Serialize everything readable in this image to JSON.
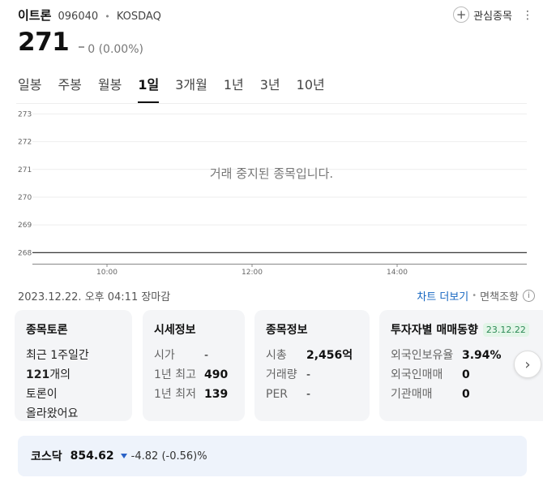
{
  "stock": {
    "name": "이트론",
    "code": "096040",
    "separator": "•",
    "market": "KOSDAQ",
    "price": "271",
    "change": "0 (0.00%)"
  },
  "header": {
    "watch_label": "관심종목"
  },
  "tabs": [
    {
      "label": "일봉",
      "active": false
    },
    {
      "label": "주봉",
      "active": false
    },
    {
      "label": "월봉",
      "active": false
    },
    {
      "label": "1일",
      "active": true
    },
    {
      "label": "3개월",
      "active": false
    },
    {
      "label": "1년",
      "active": false
    },
    {
      "label": "3년",
      "active": false
    },
    {
      "label": "10년",
      "active": false
    }
  ],
  "chart_data": {
    "type": "line",
    "message": "거래 중지된 종목입니다.",
    "y_ticks": [
      273,
      272,
      271,
      270,
      269,
      268
    ],
    "ylim": [
      267.6,
      273.1
    ],
    "x_ticks": [
      "10:00",
      "12:00",
      "14:00"
    ],
    "series": [
      {
        "values": [
          268,
          268
        ]
      }
    ],
    "grid": true
  },
  "meta": {
    "timestamp": "2023.12.22. 오후 04:11 장마감",
    "chart_more": "차트 더보기",
    "separator": "•",
    "disclaimer": "면책조항",
    "info_icon": "i"
  },
  "cards": {
    "discussion": {
      "title": "종목토론",
      "line1": "최근 1주일간",
      "count": "121",
      "line2": "개의",
      "line3": "토론이",
      "line4": "올라왔어요"
    },
    "market_info": {
      "title": "시세정보",
      "rows": [
        {
          "k": "시가",
          "v": "-"
        },
        {
          "k": "1년 최고",
          "v": "490"
        },
        {
          "k": "1년 최저",
          "v": "139"
        }
      ]
    },
    "stock_info": {
      "title": "종목정보",
      "rows": [
        {
          "k": "시총",
          "v": "2,456억"
        },
        {
          "k": "거래량",
          "v": "-"
        },
        {
          "k": "PER",
          "v": "-"
        }
      ]
    },
    "investor": {
      "title": "투자자별 매매동향",
      "badge": "23.12.22",
      "rows": [
        {
          "k": "외국인보유율",
          "v": "3.94%"
        },
        {
          "k": "외국인매매",
          "v": "0"
        },
        {
          "k": "기관매매",
          "v": "0"
        }
      ]
    }
  },
  "index": {
    "name": "코스닥",
    "value": "854.62",
    "change": "-4.82 (-0.56)%"
  },
  "colors": {
    "chart_more": "#1565c0",
    "index_down": "#2a62c7",
    "badge_bg": "#e3f5e8",
    "badge_fg": "#2e8b57",
    "index_bg": "#eef3fb",
    "card_bg": "#f4f5f7"
  },
  "icons": {
    "watch": "plus-icon",
    "more": "more-vertical-icon",
    "next": "chevron-right-icon",
    "down": "triangle-down-icon",
    "info": "info-icon"
  }
}
